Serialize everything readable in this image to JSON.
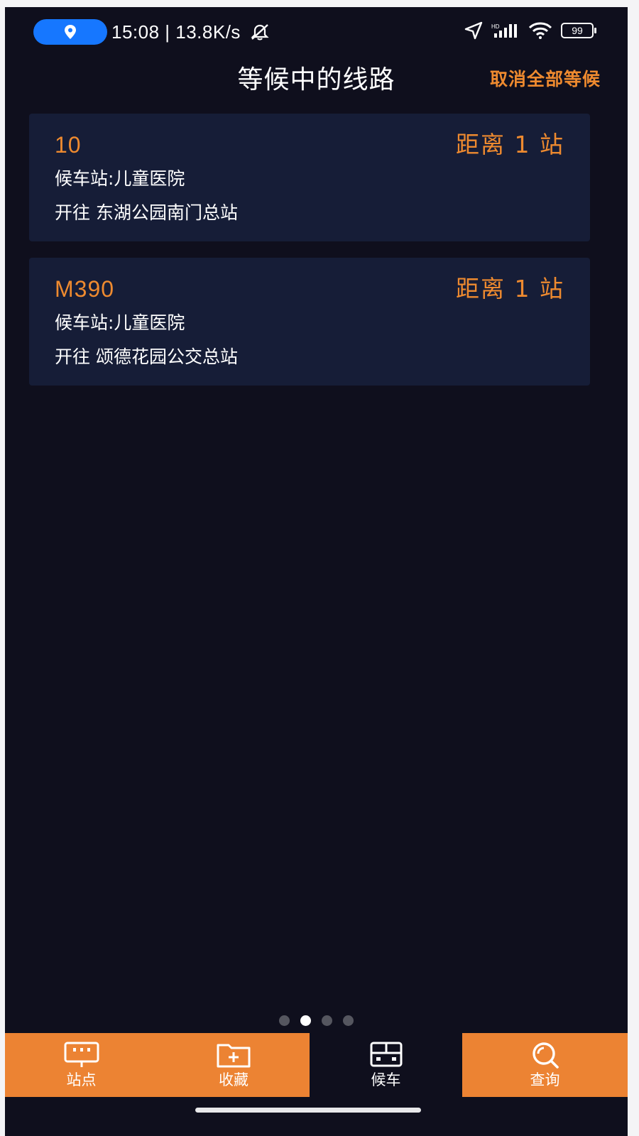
{
  "status_bar": {
    "time_speed": "15:08 | 13.8K/s",
    "battery": "99"
  },
  "header": {
    "title": "等候中的线路",
    "cancel_all": "取消全部等候"
  },
  "routes": [
    {
      "number": "10",
      "distance": "距离 1 站",
      "stop": "候车站:儿童医院",
      "destination": "开往 东湖公园南门总站"
    },
    {
      "number": "M390",
      "distance": "距离 1 站",
      "stop": "候车站:儿童医院",
      "destination": "开往 颂德花园公交总站"
    }
  ],
  "page_indicator": {
    "count": 4,
    "active_index": 1
  },
  "bottom_nav": [
    {
      "label": "站点",
      "icon": "station-icon",
      "active": false
    },
    {
      "label": "收藏",
      "icon": "favorites-folder-icon",
      "active": false
    },
    {
      "label": "候车",
      "icon": "bus-wait-icon",
      "active": true
    },
    {
      "label": "查询",
      "icon": "search-icon",
      "active": false
    }
  ],
  "colors": {
    "accent": "#ee8a2f",
    "background": "#0f0f1d",
    "card": "#161d37",
    "nav_orange": "#ec8333"
  }
}
